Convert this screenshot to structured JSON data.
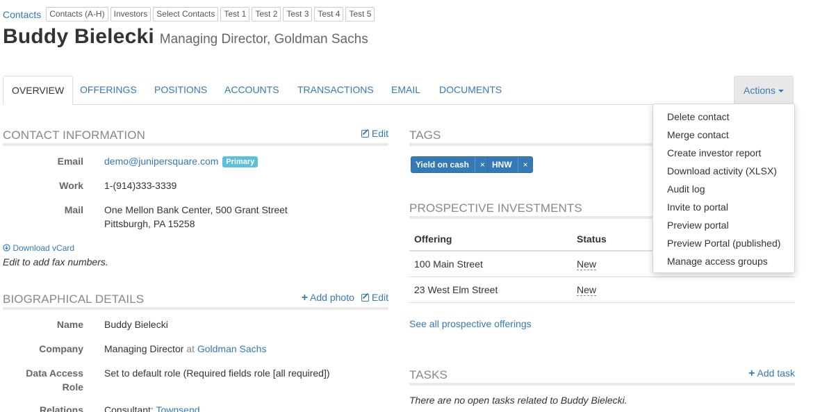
{
  "breadcrumbs": {
    "home": "Contacts",
    "chips": [
      "Contacts (A-H)",
      "Investors",
      "Select Contacts",
      "Test 1",
      "Test 2",
      "Test 3",
      "Test 4",
      "Test 5"
    ]
  },
  "header": {
    "name": "Buddy Bielecki",
    "role": "Managing Director, Goldman Sachs"
  },
  "tabs": [
    {
      "label": "OVERVIEW",
      "active": true
    },
    {
      "label": "OFFERINGS"
    },
    {
      "label": "POSITIONS"
    },
    {
      "label": "ACCOUNTS"
    },
    {
      "label": "TRANSACTIONS"
    },
    {
      "label": "EMAIL"
    },
    {
      "label": "DOCUMENTS"
    }
  ],
  "actions": {
    "label": "Actions",
    "menu": [
      "Delete contact",
      "Merge contact",
      "Create investor report",
      "Download activity (XLSX)",
      "Audit log",
      "Invite to portal",
      "Preview portal",
      "Preview Portal (published)",
      "Manage access groups"
    ]
  },
  "contact_info": {
    "heading": "CONTACT INFORMATION",
    "edit": "Edit",
    "email_label": "Email",
    "email": "demo@junipersquare.com",
    "email_badge": "Primary",
    "work_label": "Work",
    "work": "1-(914)333-3339",
    "mail_label": "Mail",
    "mail_line1": "One Mellon Bank Center, 500 Grant Street",
    "mail_line2": "Pittsburgh, PA 15258",
    "vcard": "Download vCard",
    "fax_note": "Edit to add fax numbers."
  },
  "bio": {
    "heading": "BIOGRAPHICAL DETAILS",
    "add_photo": "Add photo",
    "edit": "Edit",
    "name_label": "Name",
    "name": "Buddy Bielecki",
    "company_label": "Company",
    "company_title": "Managing Director",
    "company_at": "at",
    "company_link": "Goldman Sachs",
    "role_label_1": "Data Access",
    "role_label_2": "Role",
    "role_value": "Set to default role (Required fields role [all required])",
    "relations_label": "Relations",
    "relations_prefix": "Consultant:",
    "relations_link": "Townsend"
  },
  "tags": {
    "heading": "TAGS",
    "items": [
      "Yield on cash",
      "HNW"
    ],
    "remove_glyph": "×"
  },
  "prospective": {
    "heading": "PROSPECTIVE INVESTMENTS",
    "col_offering": "Offering",
    "col_status": "Status",
    "rows": [
      {
        "offering": "100 Main Street",
        "status": "New"
      },
      {
        "offering": "23 West Elm Street",
        "status": "New"
      }
    ],
    "see_all": "See all prospective offerings"
  },
  "tasks": {
    "heading": "TASKS",
    "add": "Add task",
    "empty_prefix": "There are no open tasks related to",
    "empty_name": "Buddy Bielecki"
  }
}
